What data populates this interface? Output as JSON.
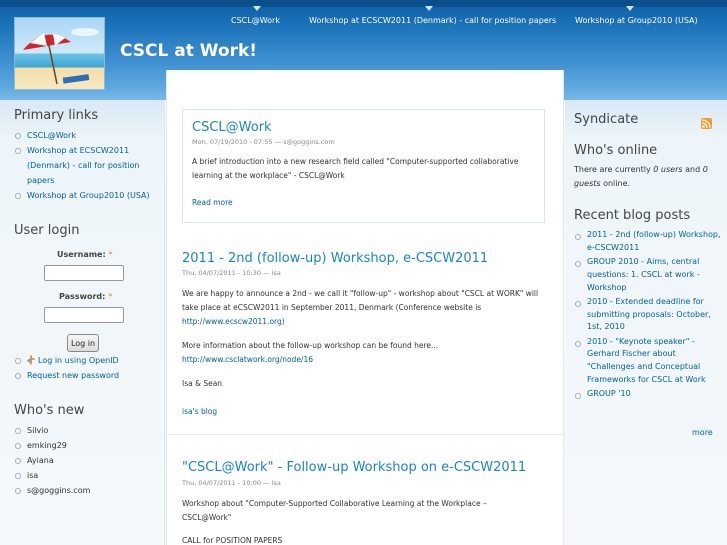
{
  "header": {
    "site_name": "CSCL at Work!",
    "nav": [
      {
        "label": "CSCL@Work"
      },
      {
        "label": "Workshop at ECSCW2011 (Denmark) - call for position papers"
      },
      {
        "label": "Workshop at Group2010 (USA)"
      }
    ]
  },
  "sidebar_left": {
    "primary_links": {
      "title": "Primary links",
      "items": [
        {
          "label": "CSCL@Work"
        },
        {
          "label": "Workshop at ECSCW2011 (Denmark) - call for position papers"
        },
        {
          "label": "Workshop at Group2010 (USA)"
        }
      ]
    },
    "user_login": {
      "title": "User login",
      "username_label": "Username:",
      "password_label": "Password:",
      "required_marker": "*",
      "username_value": "",
      "password_value": "",
      "button_label": "Log in",
      "links": [
        {
          "label": "Log in using OpenID"
        },
        {
          "label": "Request new password"
        }
      ]
    },
    "whos_new": {
      "title": "Who's new",
      "users": [
        "Silvio",
        "emking29",
        "Ayiana",
        "isa",
        "s@goggins.com"
      ]
    }
  },
  "main": {
    "nodes": [
      {
        "title": "CSCL@Work",
        "meta": "Mon, 07/19/2010 - 07:55 — s@goggins.com",
        "paragraphs": [
          "A brief introduction into a new research field called \"Computer-supported collaborative learning at the workplace\" - CSCL@Work"
        ],
        "link": "Read more"
      },
      {
        "title": "2011 - 2nd (follow-up) Workshop, e-CSCW2011",
        "meta": "Thu, 04/07/2011 - 10:30 — isa",
        "p1": "We are happy to announce a 2nd - we call it \"follow-up\" - workshop about \"CSCL at WORK\" will take place at eCSCW2011 in September 2011, Denmark (Conference website is",
        "p1_link": "http://www.ecscw2011.org)",
        "p2": "More information about the follow-up workshop can be found here...",
        "p2_link": "http://www.csclatwork.org/node/16",
        "p3": "Isa & Sean",
        "link": "isa's blog"
      },
      {
        "title": "\"CSCL@Work\" - Follow-up Workshop on e-CSCW2011",
        "meta": "Thu, 04/07/2011 - 10:00 — isa",
        "p1": "Workshop about \"Computer-Supported Collaborative Learning at the Workplace – CSCL@Work\"",
        "p2": "CALL for POSITION PAPERS"
      }
    ]
  },
  "sidebar_right": {
    "syndicate": {
      "title": "Syndicate",
      "icon": "rss-feed-icon"
    },
    "whos_online": {
      "title": "Who's online",
      "text_before": "There are currently ",
      "users": "0 users",
      "text_middle": " and ",
      "guests": "0 guests",
      "text_after": " online."
    },
    "recent_posts": {
      "title": "Recent blog posts",
      "items": [
        {
          "label": "2011 - 2nd (follow-up) Workshop, e-CSCW2011"
        },
        {
          "label": "GROUP 2010 - Aims, central questions: 1. CSCL at work - Workshop"
        },
        {
          "label": "2010 - Extended deadline for submitting proposals: October, 1st, 2010"
        },
        {
          "label": "2010 - \"Keynote speaker\" - Gerhard Fischer about \"Challenges and Conceptual Frameworks for CSCL at Work"
        },
        {
          "label": "GROUP '10"
        }
      ],
      "more": "more"
    }
  },
  "colors": {
    "header_blue": "#1c72b8",
    "link": "#0062a0",
    "title_blue": "#1a85c6",
    "feed_orange": "#f29c2b"
  }
}
